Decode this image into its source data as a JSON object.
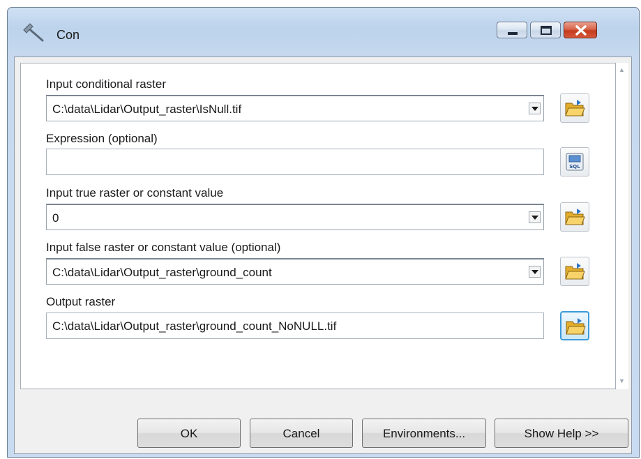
{
  "window": {
    "title": "Con",
    "title_icon": "hammer-icon",
    "controls": [
      "minimize-icon",
      "maximize-icon",
      "close-icon"
    ]
  },
  "params": {
    "input_conditional": {
      "label": "Input conditional raster",
      "value": "C:\\data\\Lidar\\Output_raster\\IsNull.tif"
    },
    "expression": {
      "label": "Expression (optional)",
      "value": ""
    },
    "input_true": {
      "label": "Input true raster or constant value",
      "value": "0"
    },
    "input_false": {
      "label": "Input false raster or constant value (optional)",
      "value": "C:\\data\\Lidar\\Output_raster\\ground_count"
    },
    "output_raster": {
      "label": "Output raster",
      "value": "C:\\data\\Lidar\\Output_raster\\ground_count_NoNULL.tif"
    }
  },
  "buttons": {
    "ok": "OK",
    "cancel": "Cancel",
    "environments": "Environments...",
    "show_help": "Show Help >>"
  },
  "icons": {
    "browse": "folder-open-icon",
    "sql": "sql-builder-icon"
  },
  "colors": {
    "titlebar": "#c6d9ef",
    "close_button": "#c43b1d",
    "active_browse_border": "#3c9ad9",
    "folder": "#f2c74e"
  }
}
